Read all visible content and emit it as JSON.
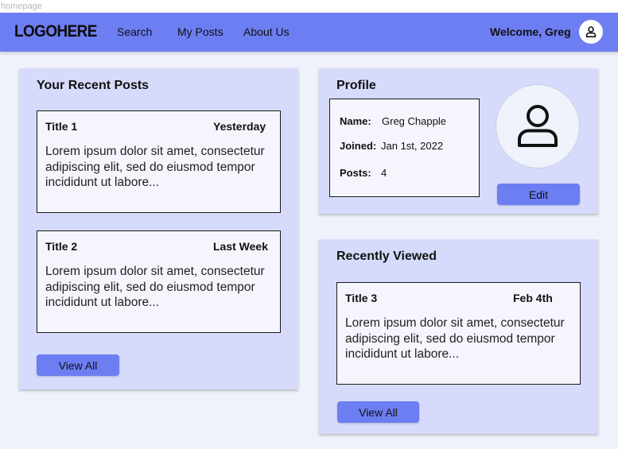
{
  "frame": {
    "label": "homepage"
  },
  "header": {
    "logo": "LOGOHERE",
    "nav": [
      "Search",
      "My Posts",
      "About Us"
    ],
    "welcome": "Welcome, Greg",
    "avatar_icon": "user-icon"
  },
  "recent_posts": {
    "title": "Your Recent Posts",
    "posts": [
      {
        "title": "Title 1",
        "date": "Yesterday",
        "body": "Lorem ipsum dolor sit amet, consectetur adipiscing elit, sed do eiusmod tempor incididunt ut labore..."
      },
      {
        "title": "Title 2",
        "date": "Last Week",
        "body": "Lorem ipsum dolor sit amet, consectetur adipiscing elit, sed do eiusmod tempor incididunt ut labore..."
      }
    ],
    "view_all_label": "View All"
  },
  "profile": {
    "title": "Profile",
    "fields": [
      {
        "key": "Name:",
        "value": "Greg Chapple"
      },
      {
        "key": "Joined:",
        "value": "Jan 1st,  2022"
      },
      {
        "key": "Posts:",
        "value": "4"
      }
    ],
    "picture_icon": "user-icon",
    "edit_label": "Edit"
  },
  "recently_viewed": {
    "title": "Recently Viewed",
    "posts": [
      {
        "title": "Title 3",
        "date": "Feb 4th",
        "body": "Lorem ipsum dolor sit amet, consectetur adipiscing elit, sed do eiusmod tempor incididunt ut labore..."
      }
    ],
    "view_all_label": "View All"
  },
  "colors": {
    "navbar": "#6d7df2",
    "card": "#d6dbfb",
    "button": "#6d7df2",
    "background": "#eff2fb"
  }
}
